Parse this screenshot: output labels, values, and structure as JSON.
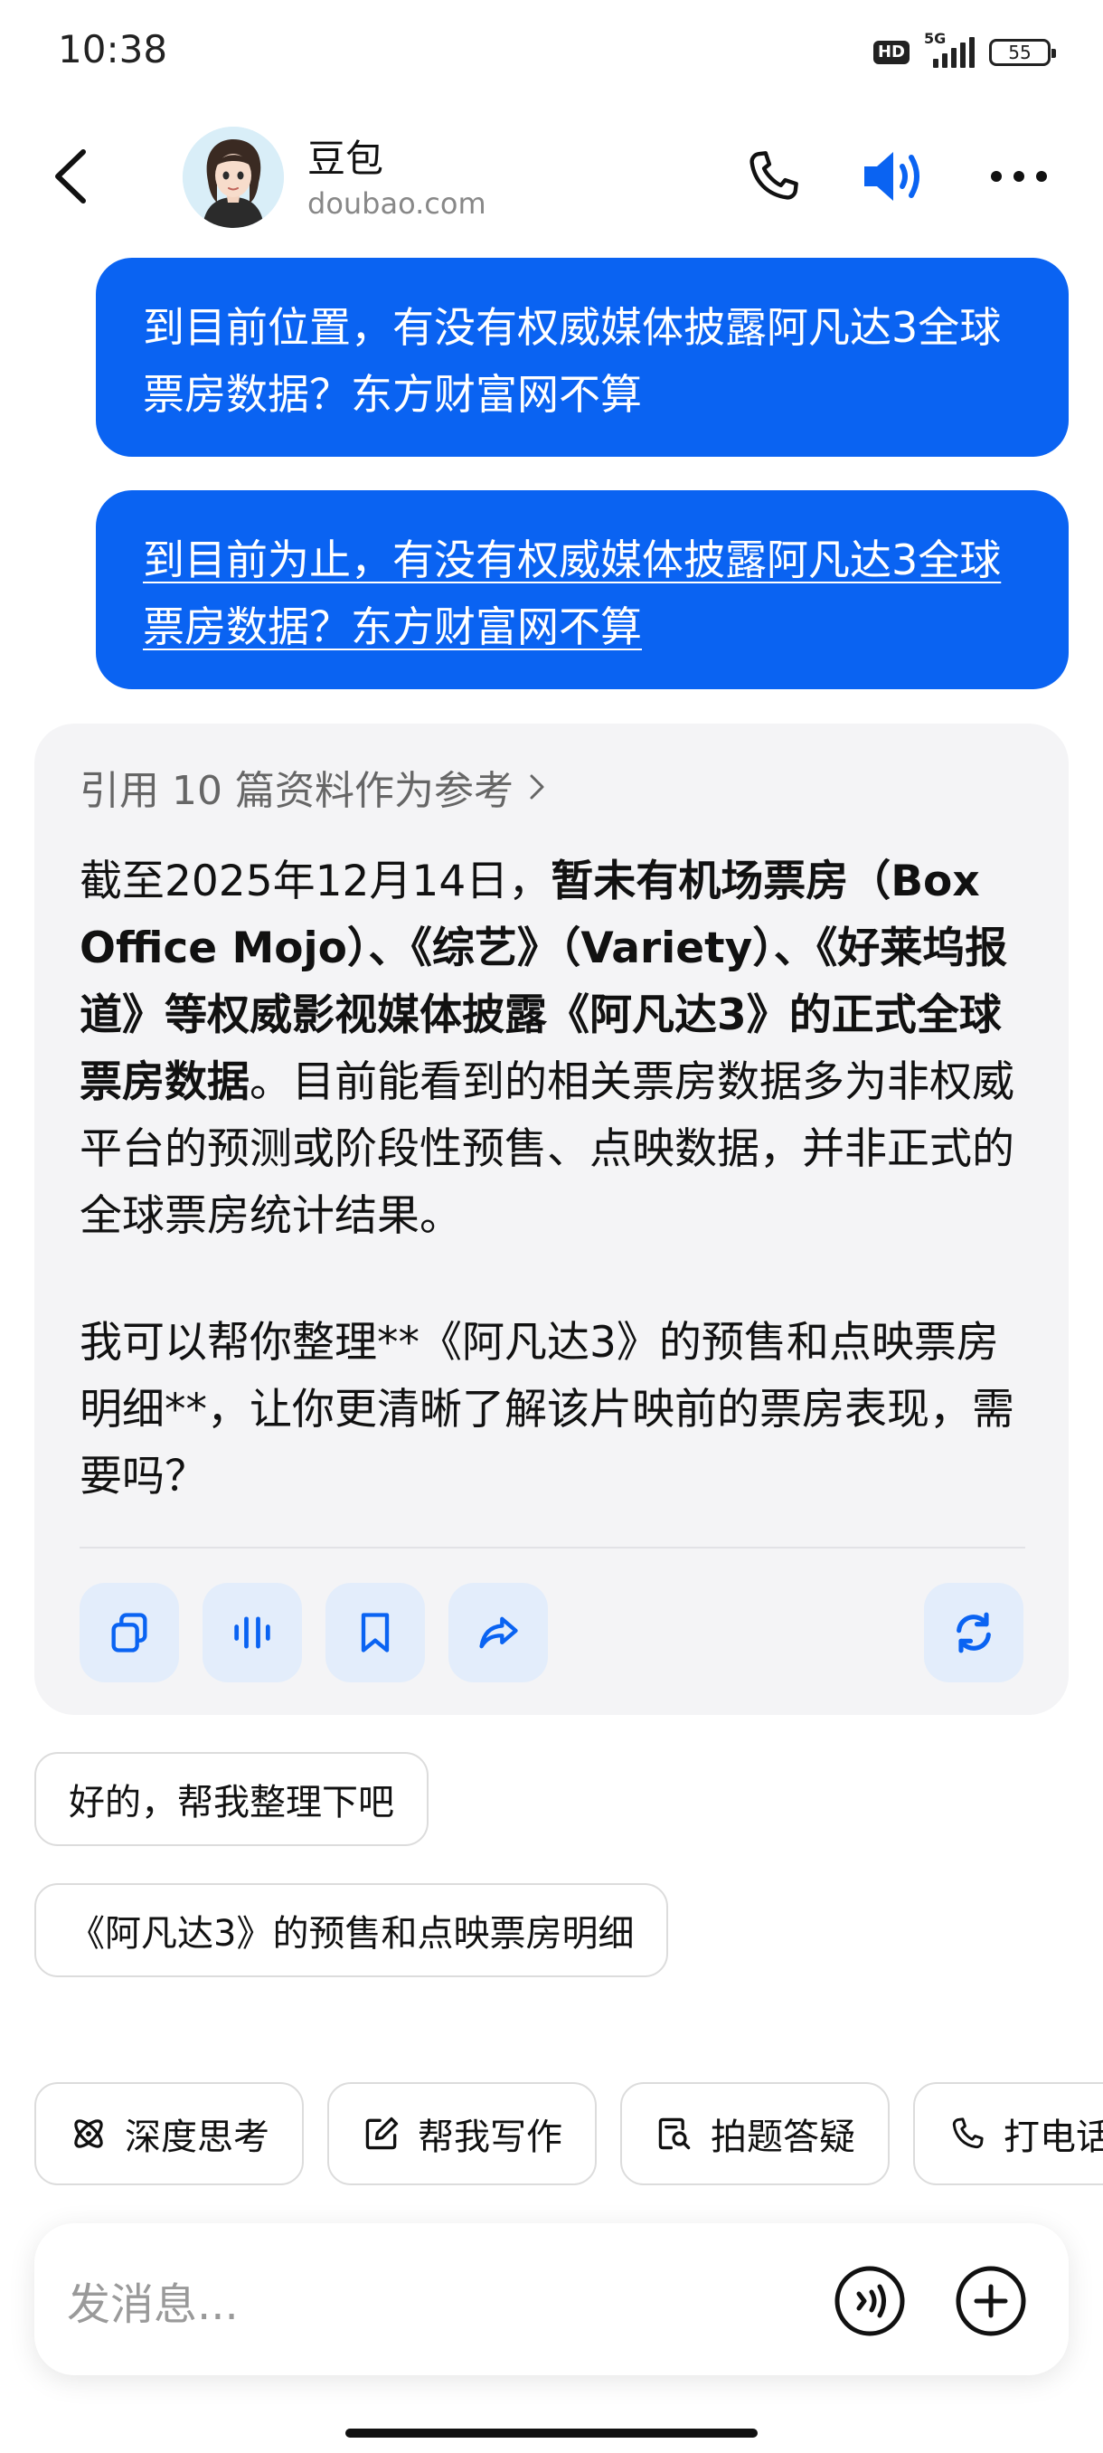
{
  "status_bar": {
    "time": "10:38",
    "hd_label": "HD",
    "network_label": "5G",
    "battery": "55"
  },
  "header": {
    "name": "豆包",
    "domain": "doubao.com"
  },
  "messages": {
    "user_1": "到目前位置，有没有权威媒体披露阿凡达3全球票房数据？东方财富网不算",
    "user_2": "到目前为止，有没有权威媒体披露阿凡达3全球票房数据？东方财富网不算"
  },
  "ai_reply": {
    "reference_label": "引用 10 篇资料作为参考",
    "para1_prefix": "截至2025年12月14日，",
    "para1_bold": "暂未有机场票房（Box Office Mojo）、《综艺》（Variety）、《好莱坞报道》等权威影视媒体披露《阿凡达3》的正式全球票房数据",
    "para1_suffix": "。目前能看到的相关票房数据多为非权威平台的预测或阶段性预售、点映数据，并非正式的全球票房统计结果。",
    "para2": "我可以帮你整理**《阿凡达3》的预售和点映票房明细**，让你更清晰了解该片映前的票房表现，需要吗？"
  },
  "suggestions": [
    "好的，帮我整理下吧",
    "《阿凡达3》的预售和点映票房明细"
  ],
  "quick_actions": [
    {
      "label": "深度思考",
      "icon": "atom-icon"
    },
    {
      "label": "帮我写作",
      "icon": "edit-icon"
    },
    {
      "label": "拍题答疑",
      "icon": "photo-search-icon"
    },
    {
      "label": "打电话",
      "icon": "phone-icon"
    }
  ],
  "input": {
    "placeholder": "发消息..."
  },
  "colors": {
    "accent": "#0a63f2",
    "card_bg": "#f4f4f6",
    "action_bg": "#e3edfb"
  }
}
